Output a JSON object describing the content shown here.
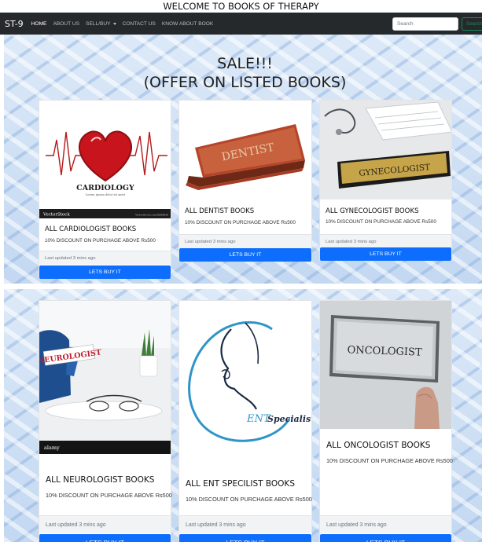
{
  "page": {
    "banner": "WELCOME TO BOOKS OF THERAPY"
  },
  "navbar": {
    "brand": "ST-9",
    "links": [
      {
        "label": "HOME",
        "active": true
      },
      {
        "label": "ABOUT US",
        "active": false
      },
      {
        "label": "SELL/BUY",
        "active": false,
        "dropdown": true
      },
      {
        "label": "CONTACT US",
        "active": false
      },
      {
        "label": "KNOW ABOUT BOOK",
        "active": false
      }
    ],
    "search_placeholder": "Search",
    "search_button": "Search"
  },
  "sale": {
    "line1": "SALE!!!",
    "line2": "(OFFER ON LISTED BOOKS)"
  },
  "cards": [
    {
      "title": "ALL CARDIOLOGIST BOOKS",
      "text": "10% DISCOUNT ON PURCHAGE ABOVE Rs500",
      "updated": "Last updated 3 mins ago",
      "button": "LETS BUY IT",
      "image_word": "CARDIOLOGY",
      "image_tagline": "Lorem ipsum dolor sit amet",
      "image_watermark": "VectorStock",
      "image_watermark_url": "VectorStock.com/28984838"
    },
    {
      "title": "ALL DENTIST BOOKS",
      "text": "10% DISCOUNT ON PURCHAGE ABOVE Rs500",
      "updated": "Last updated 3 mins ago",
      "button": "LETS BUY IT",
      "image_word": "DENTIST"
    },
    {
      "title": "ALL GYNECOLOGIST BOOKS",
      "text": "10% DISCOUNT ON PURCHAGE ABOVE Rs500",
      "updated": "Last updated 3 mins ago",
      "button": "LETS BUY IT",
      "image_word": "GYNECOLOGIST"
    },
    {
      "title": "ALL NEUROLOGIST BOOKS",
      "text": "10% DISCOUNT ON PURCHAGE ABOVE Rs500",
      "updated": "Last updated 3 mins ago",
      "button": "LETS BUY IT",
      "image_word": "NEUROLOGIST",
      "image_watermark": "alamy"
    },
    {
      "title": "ALL ENT SPECILIST BOOKS",
      "text": "10% DISCOUNT ON PURCHAGE ABOVE Rs500",
      "updated": "Last updated 3 mins ago",
      "button": "LETS BUY IT",
      "image_word": "ENT",
      "image_word2": "Specialists"
    },
    {
      "title": "ALL ONCOLOGIST BOOKS",
      "text": "10% DISCOUNT ON PURCHAGE ABOVE Rs500",
      "updated": "Last updated 3 mins ago",
      "button": "LETS BUY IT",
      "image_word": "ONCOLOGIST"
    }
  ],
  "colors": {
    "navbar": "#26292c",
    "primary_button": "#0d6efd",
    "search_button": "#198754",
    "background": "#cfe0f4"
  }
}
